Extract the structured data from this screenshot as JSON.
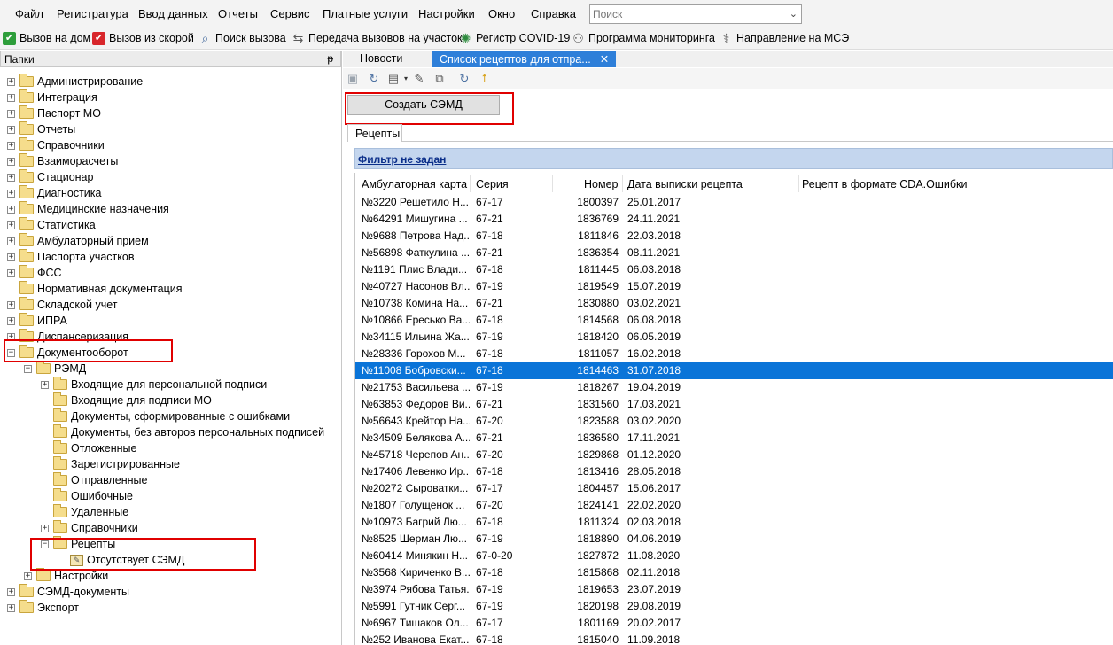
{
  "menu": {
    "items": [
      "Файл",
      "Регистратура",
      "Ввод данных",
      "Отчеты",
      "Сервис",
      "Платные услуги",
      "Настройки",
      "Окно",
      "Справка"
    ],
    "search_placeholder": "Поиск"
  },
  "quickbar": {
    "items": [
      {
        "label": "Вызов на дом",
        "icon": "green-check-icon",
        "color": "#2e9e3b"
      },
      {
        "label": "Вызов из скорой",
        "icon": "red-check-icon",
        "color": "#d8262b"
      },
      {
        "label": "Поиск вызова",
        "icon": "search-doc-icon",
        "color": "#4a6fa0"
      },
      {
        "label": "Передача вызовов на участок",
        "icon": "transfer-icon",
        "color": "#5a5a5a"
      },
      {
        "label": "Регистр COVID-19",
        "icon": "virus-icon",
        "color": "#2e8b3e"
      },
      {
        "label": "Программа мониторинга",
        "icon": "people-icon",
        "color": "#5a5a5a"
      },
      {
        "label": "Направление на МСЭ",
        "icon": "referral-icon",
        "color": "#5a5a5a"
      }
    ]
  },
  "left_panel": {
    "title": "Папки",
    "pin_glyph": "ᵽ",
    "tree": [
      {
        "label": "Администрирование",
        "level": 0,
        "exp": "+"
      },
      {
        "label": "Интеграция",
        "level": 0,
        "exp": "+"
      },
      {
        "label": "Паспорт МО",
        "level": 0,
        "exp": "+"
      },
      {
        "label": "Отчеты",
        "level": 0,
        "exp": "+"
      },
      {
        "label": "Справочники",
        "level": 0,
        "exp": "+"
      },
      {
        "label": "Взаиморасчеты",
        "level": 0,
        "exp": "+"
      },
      {
        "label": "Стационар",
        "level": 0,
        "exp": "+"
      },
      {
        "label": "Диагностика",
        "level": 0,
        "exp": "+"
      },
      {
        "label": "Медицинские назначения",
        "level": 0,
        "exp": "+"
      },
      {
        "label": "Статистика",
        "level": 0,
        "exp": "+"
      },
      {
        "label": "Амбулаторный прием",
        "level": 0,
        "exp": "+"
      },
      {
        "label": "Паспорта участков",
        "level": 0,
        "exp": "+"
      },
      {
        "label": "ФСС",
        "level": 0,
        "exp": "+"
      },
      {
        "label": "Нормативная документация",
        "level": 0,
        "exp": ""
      },
      {
        "label": "Складской учет",
        "level": 0,
        "exp": "+"
      },
      {
        "label": "ИПРА",
        "level": 0,
        "exp": "+"
      },
      {
        "label": "Диспансеризация",
        "level": 0,
        "exp": "+"
      },
      {
        "label": "Документооборот",
        "level": 0,
        "exp": "−"
      },
      {
        "label": "РЭМД",
        "level": 1,
        "exp": "−"
      },
      {
        "label": "Входящие для персональной подписи",
        "level": 2,
        "exp": "+"
      },
      {
        "label": "Входящие для подписи МО",
        "level": 2,
        "exp": ""
      },
      {
        "label": "Документы, сформированные с ошибками",
        "level": 2,
        "exp": ""
      },
      {
        "label": "Документы, без авторов персональных подписей",
        "level": 2,
        "exp": ""
      },
      {
        "label": "Отложенные",
        "level": 2,
        "exp": ""
      },
      {
        "label": "Зарегистрированные",
        "level": 2,
        "exp": ""
      },
      {
        "label": "Отправленные",
        "level": 2,
        "exp": ""
      },
      {
        "label": "Ошибочные",
        "level": 2,
        "exp": ""
      },
      {
        "label": "Удаленные",
        "level": 2,
        "exp": ""
      },
      {
        "label": "Справочники",
        "level": 2,
        "exp": "+"
      },
      {
        "label": "Рецепты",
        "level": 2,
        "exp": "−"
      },
      {
        "label": "Отсутствует СЭМД",
        "level": 3,
        "exp": "",
        "doc": true
      },
      {
        "label": "Настройки",
        "level": 1,
        "exp": "+"
      },
      {
        "label": "СЭМД-документы",
        "level": 0,
        "exp": "+"
      },
      {
        "label": "Экспорт",
        "level": 0,
        "exp": "+"
      }
    ]
  },
  "tabs": [
    {
      "label": "Новости",
      "active": false
    },
    {
      "label": "Список рецептов для отпра...",
      "active": true,
      "close": "✕"
    }
  ],
  "create_button": "Создать СЭМД",
  "subtab": "Рецепты",
  "filter": "Фильтр не задан",
  "grid": {
    "columns": [
      "Амбулаторная карта",
      "Серия",
      "Номер",
      "Дата выписки рецепта",
      "Рецепт в формате CDA.Ошибки"
    ],
    "selected_index": 10,
    "rows": [
      [
        "№3220 Решетило Н...",
        "67-17",
        "1800397",
        "25.01.2017"
      ],
      [
        "№64291 Мишугина ...",
        "67-21",
        "1836769",
        "24.11.2021"
      ],
      [
        "№9688 Петрова Над...",
        "67-18",
        "1811846",
        "22.03.2018"
      ],
      [
        "№56898 Фаткулина ...",
        "67-21",
        "1836354",
        "08.11.2021"
      ],
      [
        "№1191 Плис Влади...",
        "67-18",
        "1811445",
        "06.03.2018"
      ],
      [
        "№40727 Насонов Вл...",
        "67-19",
        "1819549",
        "15.07.2019"
      ],
      [
        "№10738 Комина На...",
        "67-21",
        "1830880",
        "03.02.2021"
      ],
      [
        "№10866 Ересько Ва...",
        "67-18",
        "1814568",
        "06.08.2018"
      ],
      [
        "№34115 Ильина Жа...",
        "67-19",
        "1818420",
        "06.05.2019"
      ],
      [
        "№28336 Горохов М...",
        "67-18",
        "1811057",
        "16.02.2018"
      ],
      [
        "№11008 Бобровски...",
        "67-18",
        "1814463",
        "31.07.2018"
      ],
      [
        "№21753 Васильева ...",
        "67-19",
        "1818267",
        "19.04.2019"
      ],
      [
        "№63853 Федоров Ви...",
        "67-21",
        "1831560",
        "17.03.2021"
      ],
      [
        "№56643 Крейтор На...",
        "67-20",
        "1823588",
        "03.02.2020"
      ],
      [
        "№34509 Белякова А...",
        "67-21",
        "1836580",
        "17.11.2021"
      ],
      [
        "№45718 Черепов Ан...",
        "67-20",
        "1829868",
        "01.12.2020"
      ],
      [
        "№17406 Левенко Ир...",
        "67-18",
        "1813416",
        "28.05.2018"
      ],
      [
        "№20272 Сыроватки...",
        "67-17",
        "1804457",
        "15.06.2017"
      ],
      [
        "№1807 Голущенок ...",
        "67-20",
        "1824141",
        "22.02.2020"
      ],
      [
        "№10973 Багрий Лю...",
        "67-18",
        "1811324",
        "02.03.2018"
      ],
      [
        "№8525 Шерман Лю...",
        "67-19",
        "1818890",
        "04.06.2019"
      ],
      [
        "№60414 Минякин Н...",
        "67-0-20",
        "1827872",
        "11.08.2020"
      ],
      [
        "№3568 Кириченко В...",
        "67-18",
        "1815868",
        "02.11.2018"
      ],
      [
        "№3974 Рябова Татья...",
        "67-19",
        "1819653",
        "23.07.2019"
      ],
      [
        "№5991 Гутник Серг...",
        "67-19",
        "1820198",
        "29.08.2019"
      ],
      [
        "№6967 Тишаков Ол...",
        "67-17",
        "1801169",
        "20.02.2017"
      ],
      [
        "№252 Иванова Екат...",
        "67-18",
        "1815040",
        "11.09.2018"
      ]
    ]
  },
  "colors": {
    "selection": "#0a74d8",
    "active_tab": "#2e7fd9",
    "highlight_box": "#e00000",
    "filter_bar": "#c4d6ee"
  }
}
